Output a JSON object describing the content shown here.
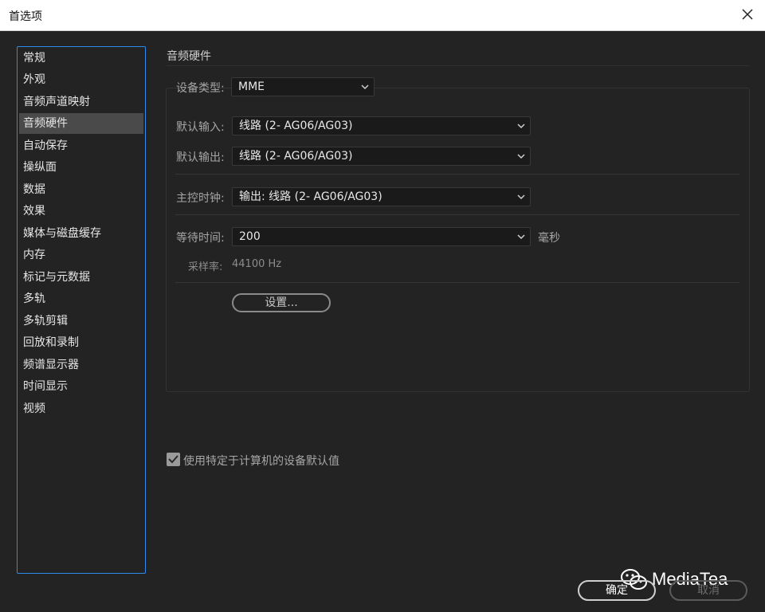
{
  "window": {
    "title": "首选项"
  },
  "sidebar": {
    "items": [
      {
        "label": "常规"
      },
      {
        "label": "外观"
      },
      {
        "label": "音频声道映射"
      },
      {
        "label": "音频硬件",
        "active": true
      },
      {
        "label": "自动保存"
      },
      {
        "label": "操纵面"
      },
      {
        "label": "数据"
      },
      {
        "label": "效果"
      },
      {
        "label": "媒体与磁盘缓存"
      },
      {
        "label": "内存"
      },
      {
        "label": "标记与元数据"
      },
      {
        "label": "多轨"
      },
      {
        "label": "多轨剪辑"
      },
      {
        "label": "回放和录制"
      },
      {
        "label": "频谱显示器"
      },
      {
        "label": "时间显示"
      },
      {
        "label": "视频"
      }
    ]
  },
  "main": {
    "section_title": "音频硬件",
    "device_type": {
      "label": "设备类型:",
      "value": "MME"
    },
    "default_input": {
      "label": "默认输入:",
      "value": "线路 (2- AG06/AG03)"
    },
    "default_output": {
      "label": "默认输出:",
      "value": "线路 (2- AG06/AG03)"
    },
    "master_clock": {
      "label": "主控时钟:",
      "value": "输出: 线路 (2- AG06/AG03)"
    },
    "latency": {
      "label": "等待时间:",
      "value": "200",
      "unit": "毫秒"
    },
    "sample_rate": {
      "label": "采样率:",
      "value": "44100 Hz"
    },
    "settings_button": "设置...",
    "use_device_defaults": {
      "label": "使用特定于计算机的设备默认值",
      "checked": true
    }
  },
  "footer": {
    "ok_label": "确定",
    "cancel_label": "取消"
  },
  "watermark": {
    "text": "MediaTea"
  },
  "colors": {
    "accent": "#2d8ceb",
    "background": "#232323",
    "active_item": "#4a4a4a"
  }
}
